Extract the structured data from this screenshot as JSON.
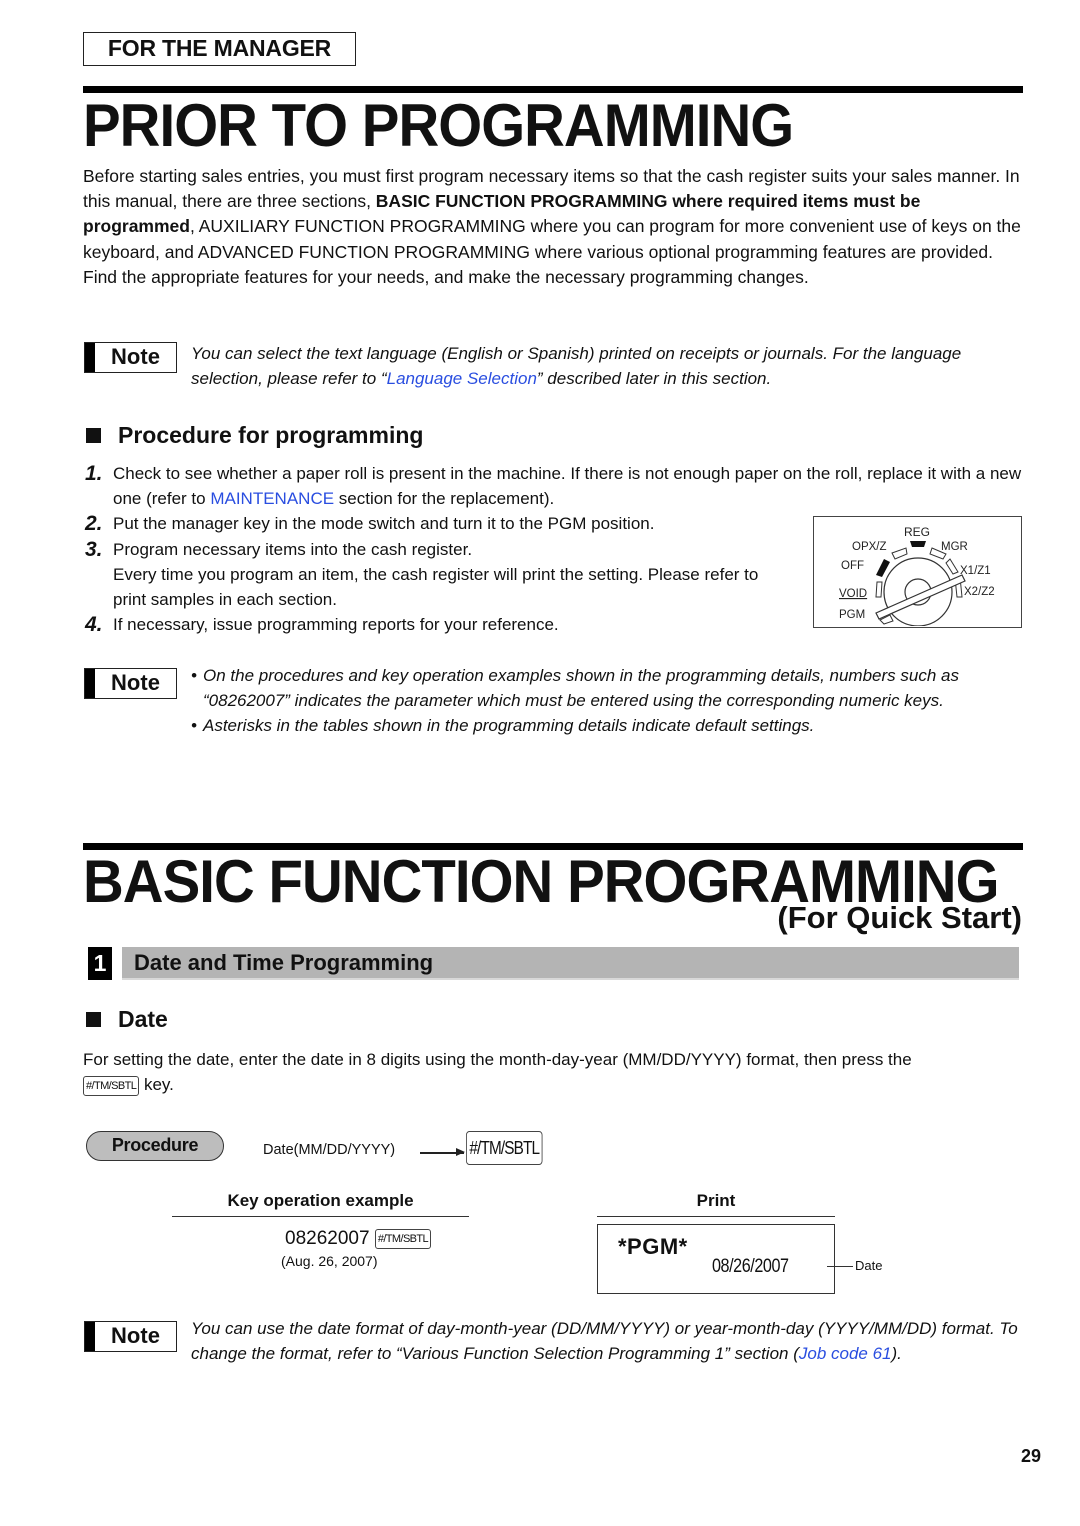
{
  "header": {
    "manager_label": "FOR THE MANAGER",
    "title": "PRIOR TO PROGRAMMING"
  },
  "intro": {
    "part1": "Before starting sales entries, you must first program necessary items so that the cash register suits your sales manner.  In this manual, there are three sections, ",
    "bold": "BASIC FUNCTION PROGRAMMING where required items must be programmed",
    "part2": ", AUXILIARY FUNCTION PROGRAMMING where you can program for more convenient use of keys on the keyboard, and ADVANCED FUNCTION PROGRAMMING where various optional programming features are provided.  Find the appropriate features for your needs, and make the necessary programming changes."
  },
  "note_label": "Note",
  "note1": {
    "before": "You can select the text language (English or Spanish) printed on receipts or journals.  For the language selection, please refer to “",
    "link": "Language Selection",
    "after": "” described later in this section."
  },
  "procedure_section": {
    "heading": "Procedure for programming",
    "steps": [
      {
        "num": "1.",
        "before": "Check to see whether a paper roll is present in the machine.  If there is not enough paper on the roll, replace it with a new one (refer to ",
        "link": "MAINTENANCE",
        "after": " section for the replacement)."
      },
      {
        "num": "2.",
        "text": "Put the manager key in the mode switch and turn it to the PGM position."
      },
      {
        "num": "3.",
        "text": "Program necessary items into the cash register.",
        "extra": "Every time you program an item, the cash register will print the setting.  Please refer to print samples in each section."
      },
      {
        "num": "4.",
        "text": "If necessary, issue programming reports for your reference."
      }
    ],
    "mode_switch": {
      "positions": [
        "REG",
        "OPX/Z",
        "MGR",
        "OFF",
        "X1/Z1",
        "VOID",
        "X2/Z2",
        "PGM"
      ],
      "current": "PGM"
    }
  },
  "note2": {
    "bullets": [
      "On the procedures and key operation examples shown in the programming details, numbers such as “08262007” indicates the parameter which must be entered using the corresponding numeric keys.",
      "Asterisks in the tables shown in the programming details indicate default settings."
    ]
  },
  "basic": {
    "title": "BASIC FUNCTION PROGRAMMING",
    "subtitle": "(For Quick Start)",
    "section_num": "1",
    "section_title": "Date and Time Programming",
    "date_heading": "Date",
    "date_desc": "For setting the date, enter the date in 8 digits using the month-day-year (MM/DD/YYYY) format, then press the",
    "date_desc_end": "key.",
    "key_label": "#/TM/SBTL",
    "procedure_label": "Procedure",
    "procedure_input": "Date(MM/DD/YYYY)",
    "key_op_header": "Key operation example",
    "key_op_value": "08262007",
    "key_op_note": "(Aug. 26, 2007)",
    "print_header": "Print",
    "print_mode": "*PGM*",
    "print_date": "08/26/2007",
    "print_date_label": "Date"
  },
  "note3": {
    "before": "You can use the date format of day-month-year (DD/MM/YYYY) or year-month-day (YYYY/MM/DD) format.  To change the format, refer to “Various Function Selection Programming 1” section (",
    "link": "Job code 61",
    "after": ")."
  },
  "page_number": "29",
  "colors": {
    "link": "#2a4ee0",
    "section_bar": "#b4b4b4",
    "procedure_pill": "#bdbdbd"
  }
}
